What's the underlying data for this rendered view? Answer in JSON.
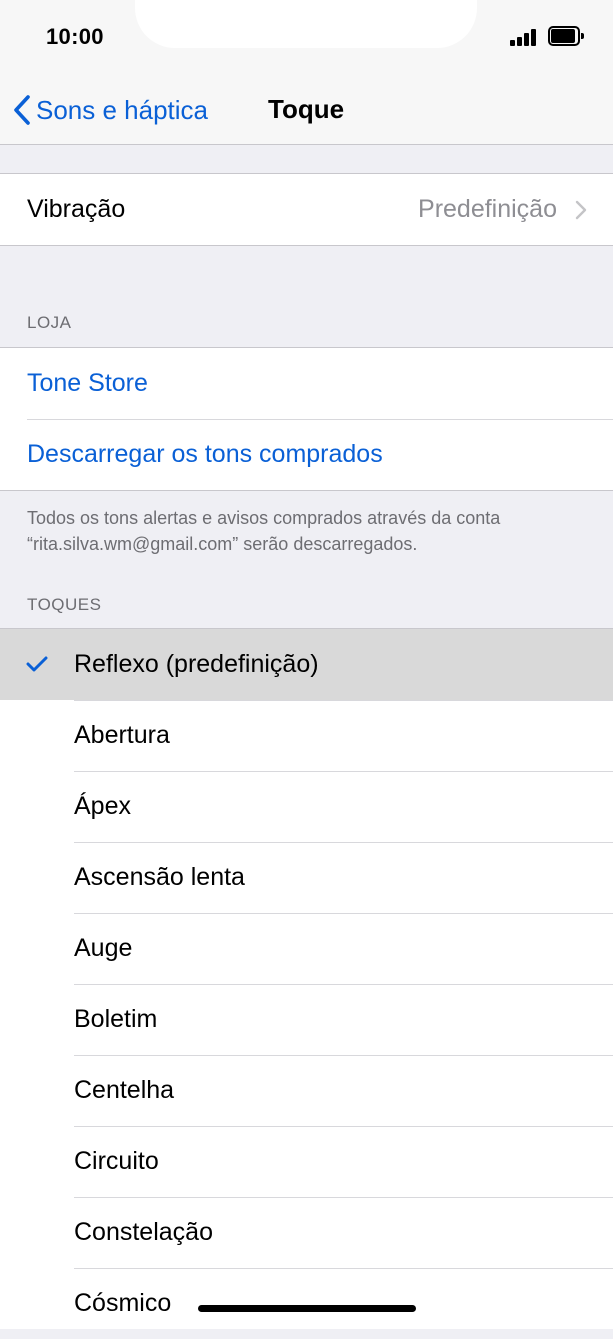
{
  "status": {
    "time": "10:00"
  },
  "nav": {
    "back_label": "Sons e háptica",
    "title": "Toque"
  },
  "vibration": {
    "label": "Vibração",
    "value": "Predefinição"
  },
  "store": {
    "header": "LOJA",
    "tone_store": "Tone Store",
    "download": "Descarregar os tons comprados",
    "footer": "Todos os tons alertas e avisos comprados através da conta “rita.silva.wm@gmail.com” serão descarregados."
  },
  "tones": {
    "header": "TOQUES",
    "items": [
      {
        "label": "Reflexo (predefinição)",
        "selected": true
      },
      {
        "label": "Abertura"
      },
      {
        "label": "Ápex"
      },
      {
        "label": "Ascensão lenta"
      },
      {
        "label": "Auge"
      },
      {
        "label": "Boletim"
      },
      {
        "label": "Centelha"
      },
      {
        "label": "Circuito"
      },
      {
        "label": "Constelação"
      },
      {
        "label": "Cósmico"
      }
    ]
  },
  "colors": {
    "accent": "#0a60d6",
    "secondary_text": "#8e8e93",
    "grouped_bg": "#efeff4",
    "selected_row": "#d9d9d9"
  }
}
